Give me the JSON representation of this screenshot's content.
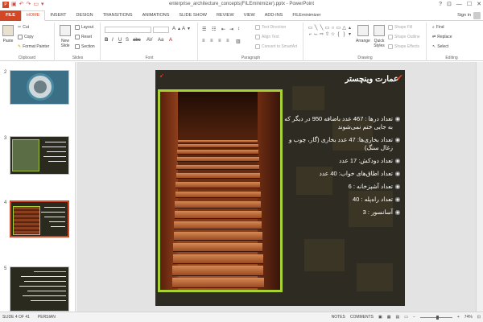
{
  "window": {
    "title": "enterprise_architecture_concepts(FILEminimizer).pptx - PowerPoint",
    "controls": [
      "?",
      "⊡",
      "—",
      "☐",
      "✕"
    ]
  },
  "tabs": [
    "FILE",
    "HOME",
    "INSERT",
    "DESIGN",
    "TRANSITIONS",
    "ANIMATIONS",
    "SLIDE SHOW",
    "REVIEW",
    "VIEW",
    "ADD-INS",
    "FILEminimizer"
  ],
  "account": {
    "sign_in": "Sign in"
  },
  "ribbon": {
    "clipboard": {
      "label": "Clipboard",
      "paste": "Paste",
      "cut": "Cut",
      "copy": "Copy",
      "format_painter": "Format Painter"
    },
    "slides": {
      "label": "Slides",
      "new_slide": "New Slide",
      "layout": "Layout",
      "reset": "Reset",
      "section": "Section"
    },
    "font": {
      "label": "Font"
    },
    "paragraph": {
      "label": "Paragraph",
      "text_direction": "Text Direction",
      "align_text": "Align Text",
      "convert_smartart": "Convert to SmartArt"
    },
    "drawing": {
      "label": "Drawing",
      "arrange": "Arrange",
      "quick_styles": "Quick Styles",
      "shape_fill": "Shape Fill",
      "shape_outline": "Shape Outline",
      "shape_effects": "Shape Effects"
    },
    "editing": {
      "label": "Editing",
      "find": "Find",
      "replace": "Replace",
      "select": "Select"
    }
  },
  "thumbnails": [
    "2",
    "3",
    "4",
    "5"
  ],
  "slide": {
    "title": "عمارت وینچستر",
    "bullets": [
      "تعداد درها :  467 عدد باضافه 950 در دیگر که به جایی ختم نمی‌شوند",
      "تعداد بخاری‌ها: 47 عدد بخاری (گاز، چوب و زغال سنگ)",
      "تعداد دودکش:  17 عدد",
      "تعداد اطاق‌های خواب:  40 عدد",
      "تعداد آشپزخانه :    6",
      "تعداد راه‌پله :     40",
      "آسانسور   :      3"
    ]
  },
  "status": {
    "slide_info": "SLIDE 4 OF 41",
    "language": "PERSIAN",
    "notes": "NOTES",
    "comments": "COMMENTS",
    "zoom": "74%"
  }
}
